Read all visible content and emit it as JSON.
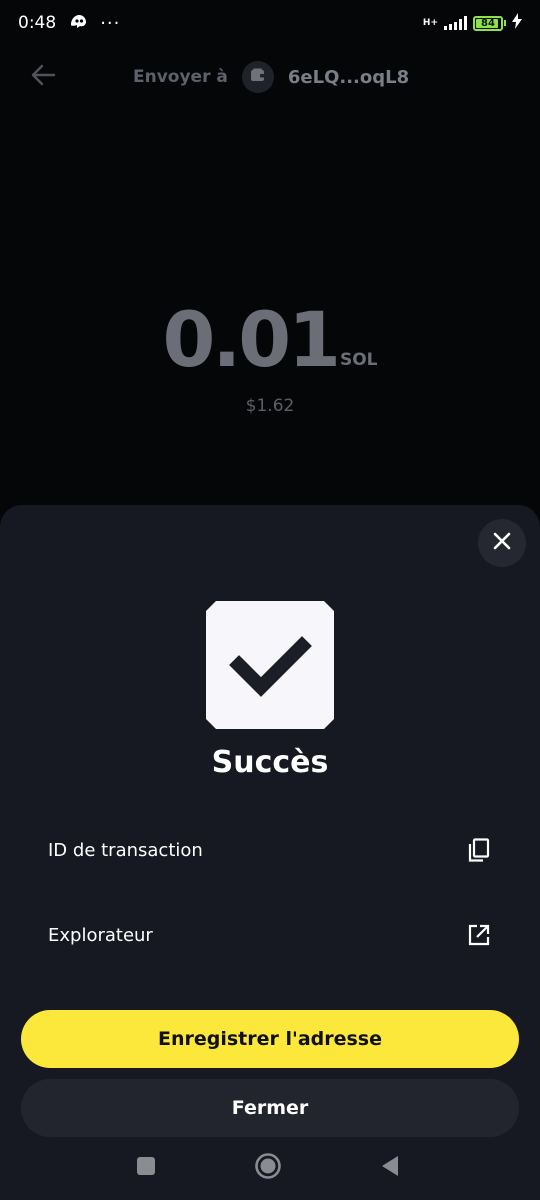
{
  "status_bar": {
    "time": "0:48",
    "dots": "···",
    "network": "H+",
    "battery": "84",
    "battery_fraction": 0.84
  },
  "header": {
    "title": "Envoyer à",
    "recipient": "6eLQ...oqL8",
    "back_icon": "arrow-left-icon",
    "wallet_icon": "wallet-icon"
  },
  "amount": {
    "value": "0.01",
    "unit": "SOL",
    "fiat": "$1.62"
  },
  "sheet": {
    "title": "Succès",
    "close_icon": "close-icon",
    "success_icon": "checkmark-icon",
    "rows": [
      {
        "label": "ID de transaction",
        "icon": "copy-icon"
      },
      {
        "label": "Explorateur",
        "icon": "external-link-icon"
      }
    ],
    "primary_label": "Enregistrer l'adresse",
    "secondary_label": "Fermer"
  },
  "colors": {
    "accent": "#fbe83a",
    "sheet_bg": "#161922",
    "screen_bg": "#050608",
    "battery": "#8ee34a"
  }
}
